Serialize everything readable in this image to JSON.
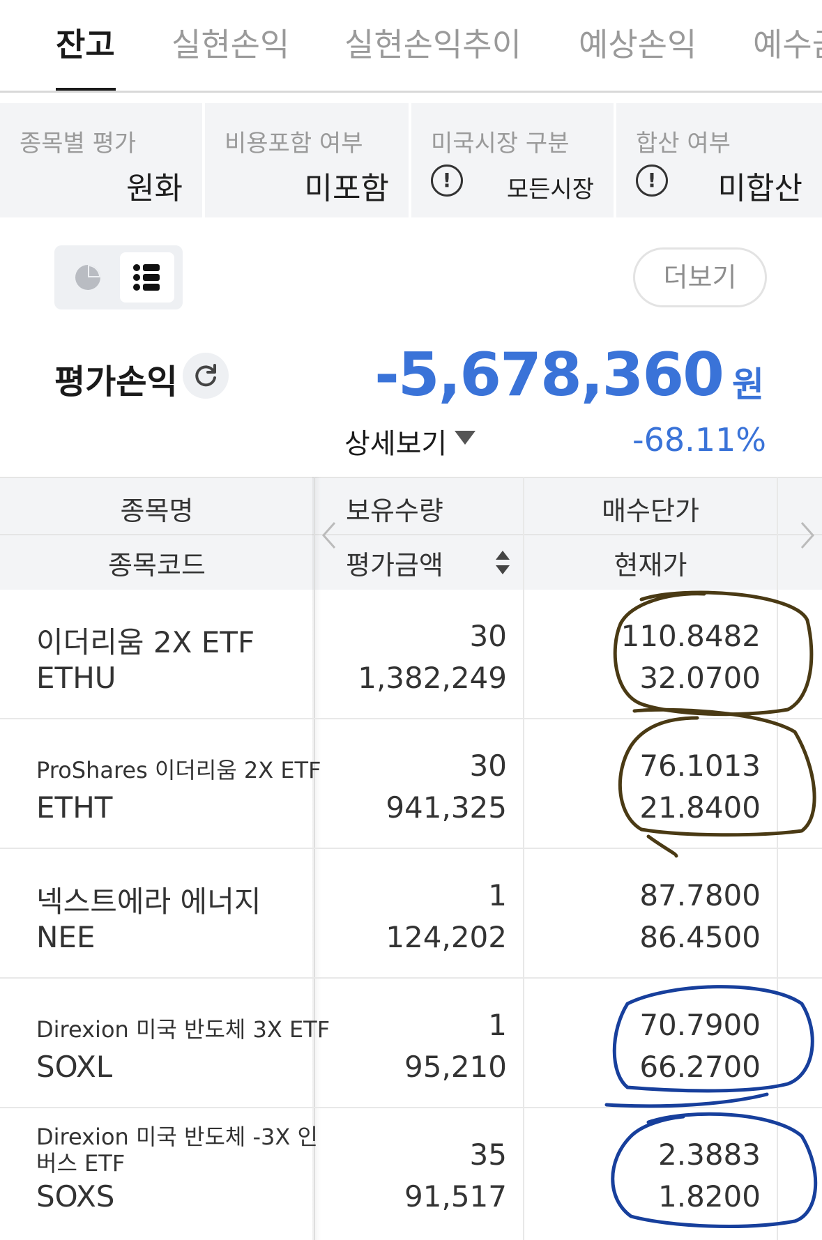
{
  "tabs": [
    {
      "label": "잔고",
      "active": true
    },
    {
      "label": "실현손익"
    },
    {
      "label": "실현손익추이"
    },
    {
      "label": "예상손익"
    },
    {
      "label": "예수금"
    }
  ],
  "settings": [
    {
      "label": "종목별 평가",
      "value": "원화"
    },
    {
      "label": "비용포함 여부",
      "value": "미포함"
    },
    {
      "label": "미국시장 구분",
      "value": "모든시장",
      "info_icon": "!"
    },
    {
      "label": "합산 여부",
      "value": "미합산",
      "info_icon": "!"
    }
  ],
  "more_button": "더보기",
  "pnl": {
    "label": "평가손익",
    "amount": "-5,678,360",
    "unit": "원",
    "detail": "상세보기",
    "rate": "-68.11%"
  },
  "table": {
    "header_top": [
      "종목명",
      "보유수량",
      "매수단가"
    ],
    "header_bottom": [
      "종목코드",
      "평가금액",
      "현재가"
    ],
    "rows": [
      {
        "name": "이더리움 2X ETF",
        "code": "ETHU",
        "qty": "30",
        "amount": "1,382,249",
        "buy_price": "110.8482",
        "cur_price": "32.0700"
      },
      {
        "name": "ProShares 이더리움 2X ETF",
        "code": "ETHT",
        "qty": "30",
        "amount": "941,325",
        "buy_price": "76.1013",
        "cur_price": "21.8400"
      },
      {
        "name": "넥스트에라 에너지",
        "code": "NEE",
        "qty": "1",
        "amount": "124,202",
        "buy_price": "87.7800",
        "cur_price": "86.4500"
      },
      {
        "name": "Direxion 미국 반도체 3X ETF",
        "code": "SOXL",
        "qty": "1",
        "amount": "95,210",
        "buy_price": "70.7900",
        "cur_price": "66.2700"
      },
      {
        "name_line1": "Direxion 미국 반도체 -3X 인",
        "name_line2": "버스 ETF",
        "code": "SOXS",
        "qty": "35",
        "amount": "91,517",
        "buy_price": "2.3883",
        "cur_price": "1.8200"
      }
    ]
  },
  "colors": {
    "accent_blue": "#3a73d8",
    "annotation_brown": "#4a3a14",
    "annotation_navy": "#173f9c"
  }
}
